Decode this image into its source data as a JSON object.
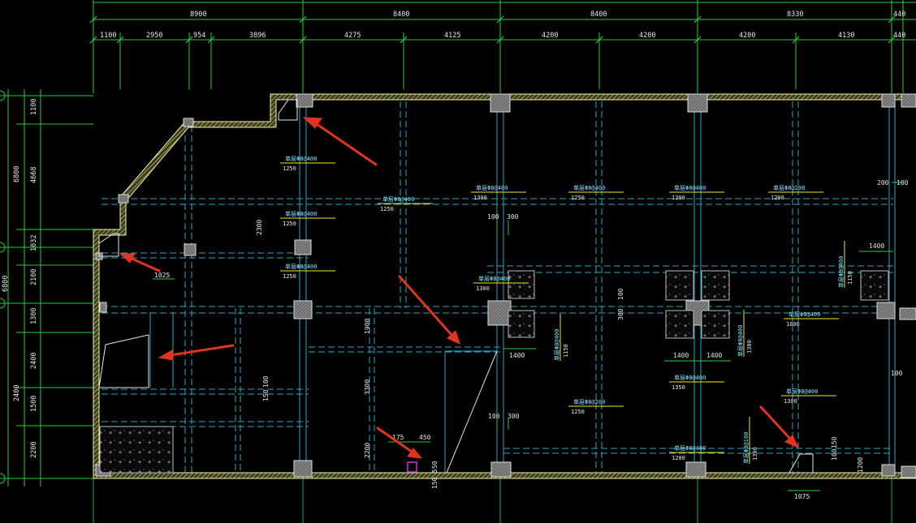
{
  "colors": {
    "background": "#000000",
    "dimension_line": "#22d12f",
    "grid_axis": "#1aa84a",
    "beam_line": "#27a9c2",
    "wall_outline": "#f4f4a0",
    "wall_hatch": "#b9b97a",
    "column_fill": "#8a8a8a",
    "rebar_line": "#f0e62a",
    "rebar_text": "#7fe9ff",
    "text": "#e6e6e6",
    "arrow": "#e0341f",
    "magenta_mark": "#d22fd2"
  },
  "top_dimensions": {
    "row1": [
      "8900",
      "8400",
      "8400",
      "8330",
      "440"
    ],
    "row2": [
      "1100",
      "2950",
      "954",
      "3896",
      "4275",
      "4125",
      "4200",
      "4200",
      "4200",
      "4130",
      "440"
    ]
  },
  "left_dimensions": {
    "outer": [
      "6800",
      "6800",
      "2400"
    ],
    "inner": [
      "1100",
      "4668",
      "1032",
      "2100",
      "1300",
      "2400",
      "1500",
      "2200"
    ]
  },
  "rebar_labels": [
    {
      "id": "rb1",
      "spec": "单层Φ8@400",
      "length": "1250"
    },
    {
      "id": "rb2",
      "spec": "单层Φ8@400",
      "length": "1250"
    },
    {
      "id": "rb3",
      "spec": "单层Φ8@400",
      "length": "1250"
    },
    {
      "id": "rb4",
      "spec": "单层Φ8@400",
      "length": "1250"
    },
    {
      "id": "rb5",
      "spec": "单层Φ8@400",
      "length": "1300"
    },
    {
      "id": "rb6",
      "spec": "单层Φ8@400",
      "length": "1250"
    },
    {
      "id": "rb7",
      "spec": "单层Φ8@400",
      "length": "1200"
    },
    {
      "id": "rb8",
      "spec": "单层Φ8@200",
      "length": "1200"
    },
    {
      "id": "rb9",
      "spec": "单层Φ8@400",
      "length": "1300"
    },
    {
      "id": "rb10",
      "spec": "单层Φ8@400",
      "length": "1000"
    },
    {
      "id": "rb11",
      "spec": "单层Φ8@400",
      "length": "1350"
    },
    {
      "id": "rb12",
      "spec": "单层Φ8@200",
      "length": "1250"
    },
    {
      "id": "rb13",
      "spec": "单层Φ8@400",
      "length": "1300"
    },
    {
      "id": "rb14",
      "spec": "单层Φ8@400",
      "length": "1200"
    }
  ],
  "vertical_rebar_labels": [
    {
      "id": "vb1",
      "spec": "单层Φ8@400",
      "length": "1150"
    },
    {
      "id": "vb2",
      "spec": "单层Φ8@400",
      "length": "1150"
    },
    {
      "id": "vb3",
      "spec": "单层Φ8@400",
      "length": "1300"
    },
    {
      "id": "vb4",
      "spec": "单层Φ8@100",
      "length": "1300"
    }
  ],
  "annotations": {
    "a1": "1025",
    "a2": "2300",
    "a3": "100",
    "a4": "300",
    "a5": "100",
    "a6": "300",
    "a7": "1900",
    "a8": "3300",
    "a9": "150",
    "a10": "100",
    "a11": "2200",
    "a12": "175",
    "a13": "450",
    "a14": "550",
    "a15": "150",
    "a16": "100",
    "a17": "300",
    "a18": "1400",
    "a19": "1400",
    "a20": "1400",
    "a21": "1400",
    "a22": "200",
    "a23": "100",
    "a24": "100",
    "a25": "150",
    "a26": "100",
    "a27": "1200",
    "a28": "1075",
    "a29": "180",
    "a30": "100"
  }
}
